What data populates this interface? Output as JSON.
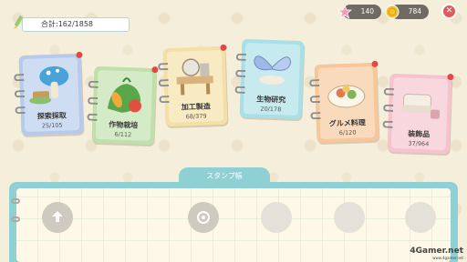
{
  "top_bar": {
    "total_label": "合計:162/1858",
    "currency": [
      {
        "name": "star-gems",
        "value": "140",
        "color": "#f59bb6"
      },
      {
        "name": "gold-coins",
        "value": "784",
        "color": "#f2c230"
      }
    ],
    "close_glyph": "✕"
  },
  "categories": [
    {
      "label": "探索採取",
      "count": "25/105",
      "color": "#b6cbeb",
      "icon": "mushroom-icon"
    },
    {
      "label": "作物栽培",
      "count": "6/112",
      "color": "#bfe0a9",
      "icon": "vegetables-icon"
    },
    {
      "label": "加工製造",
      "count": "68/379",
      "color": "#f4dfa4",
      "icon": "workbench-icon"
    },
    {
      "label": "生物研究",
      "count": "20/178",
      "color": "#a9dfe6",
      "icon": "butterfly-icon"
    },
    {
      "label": "グルメ料理",
      "count": "6/120",
      "color": "#f7c79a",
      "icon": "dish-icon"
    },
    {
      "label": "装飾品",
      "count": "37/964",
      "color": "#f6c2cc",
      "icon": "sofa-icon"
    }
  ],
  "stamp_book": {
    "title": "スタンプ帳"
  },
  "watermark": {
    "brand": "4Gamer.net",
    "url": "www.4gamer.net"
  }
}
